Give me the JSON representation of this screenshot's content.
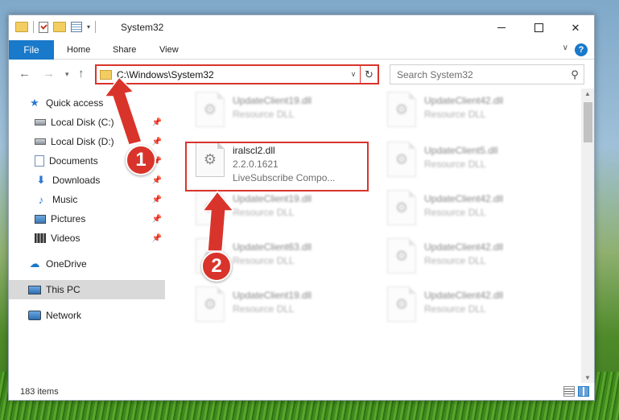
{
  "window": {
    "title": "System32"
  },
  "ribbon": {
    "file": "File",
    "home": "Home",
    "share": "Share",
    "view": "View",
    "help": "?"
  },
  "nav": {
    "address": "C:\\Windows\\System32",
    "search_placeholder": "Search System32"
  },
  "sidebar": [
    {
      "label": "Quick access",
      "icon": "star-icon"
    },
    {
      "label": "Local Disk (C:)",
      "icon": "disk-icon",
      "pinned": true
    },
    {
      "label": "Local Disk (D:)",
      "icon": "disk-icon",
      "pinned": true
    },
    {
      "label": "Documents",
      "icon": "documents-icon",
      "pinned": true
    },
    {
      "label": "Downloads",
      "icon": "download-icon",
      "pinned": true
    },
    {
      "label": "Music",
      "icon": "music-icon",
      "pinned": true
    },
    {
      "label": "Pictures",
      "icon": "pictures-icon",
      "pinned": true
    },
    {
      "label": "Videos",
      "icon": "videos-icon",
      "pinned": true
    },
    {
      "label": "OneDrive",
      "icon": "cloud-icon"
    },
    {
      "label": "This PC",
      "icon": "pc-icon",
      "selected": true
    },
    {
      "label": "Network",
      "icon": "network-icon"
    }
  ],
  "files": {
    "r0c0": {
      "name": "UpdateClient19.dll",
      "sub": "Resource DLL"
    },
    "r0c1": {
      "name": "UpdateClient42.dll",
      "sub": "Resource DLL"
    },
    "target": {
      "name": "iralscl2.dll",
      "version": "2.2.0.1621",
      "company": "LiveSubscribe Compo..."
    },
    "r1c1": {
      "name": "UpdateClient5.dll",
      "sub": "Resource DLL"
    },
    "r2c0": {
      "name": "UpdateClient19.dll",
      "sub": "Resource DLL"
    },
    "r2c1": {
      "name": "UpdateClient42.dll",
      "sub": "Resource DLL"
    },
    "r3c0": {
      "name": "UpdateClient63.dll",
      "sub": "Resource DLL"
    },
    "r3c1": {
      "name": "UpdateClient42.dll",
      "sub": "Resource DLL"
    },
    "r4c0": {
      "name": "UpdateClient19.dll",
      "sub": "Resource DLL"
    },
    "r4c1": {
      "name": "UpdateClient42.dll",
      "sub": "Resource DLL"
    }
  },
  "status": {
    "count": "183 items"
  },
  "annotations": {
    "step1": "1",
    "step2": "2",
    "color": "#d9342b"
  }
}
